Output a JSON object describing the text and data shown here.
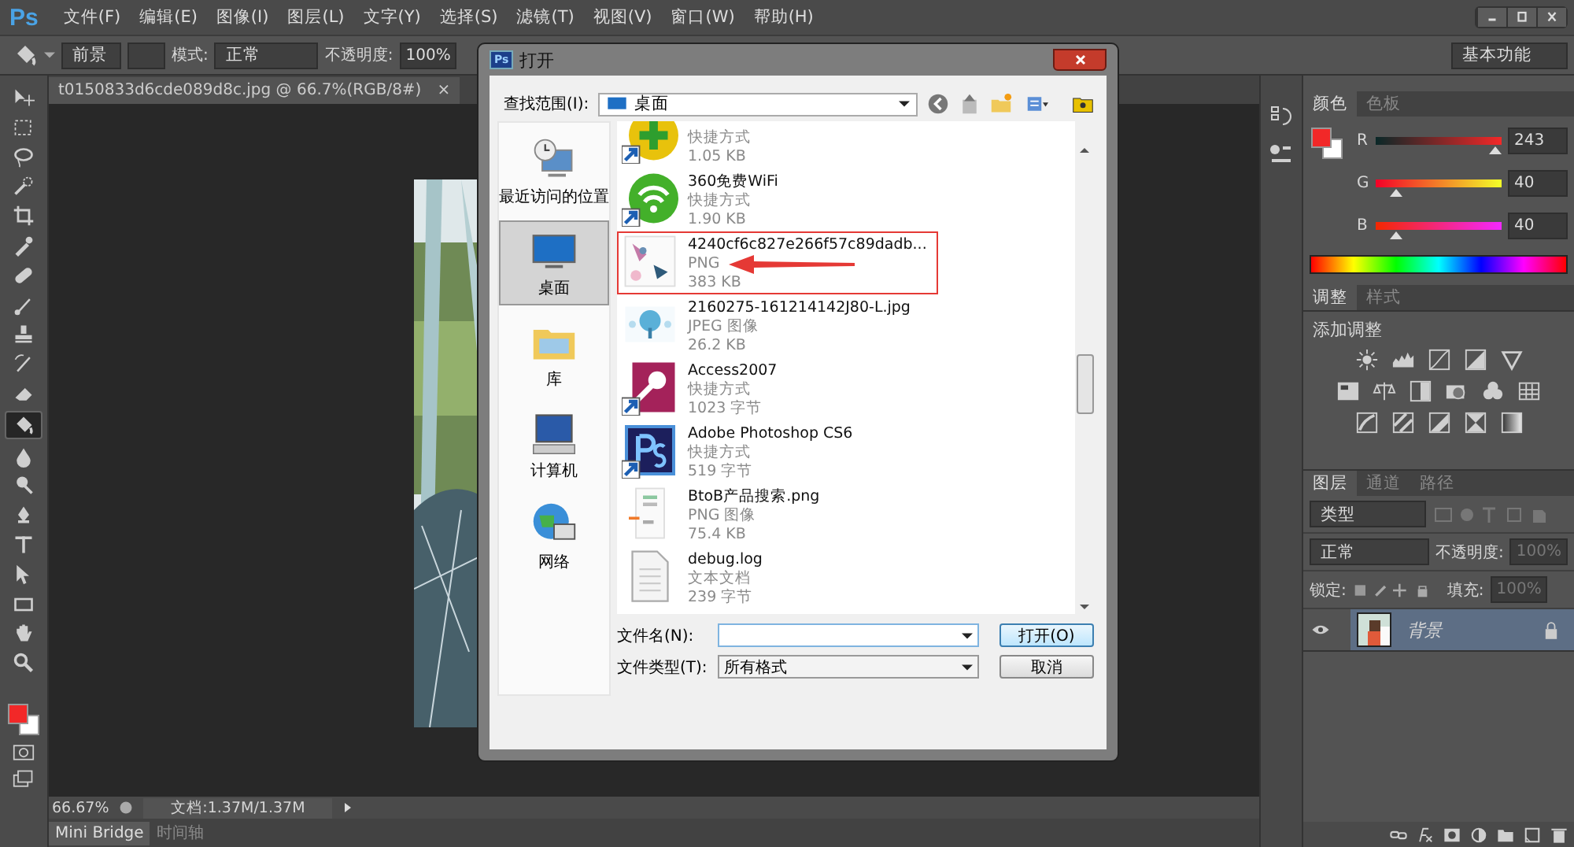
{
  "app": {
    "logo": "Ps"
  },
  "menu": [
    {
      "label": "文件(F)"
    },
    {
      "label": "编辑(E)"
    },
    {
      "label": "图像(I)"
    },
    {
      "label": "图层(L)"
    },
    {
      "label": "文字(Y)"
    },
    {
      "label": "选择(S)"
    },
    {
      "label": "滤镜(T)"
    },
    {
      "label": "视图(V)"
    },
    {
      "label": "窗口(W)"
    },
    {
      "label": "帮助(H)"
    }
  ],
  "options_bar": {
    "fill_source": "前景",
    "mode_label": "模式:",
    "mode": "正常",
    "opacity_label": "不透明度:",
    "opacity": "100%",
    "workspace": "基本功能"
  },
  "document_tab": {
    "title": "t0150833d6cde089d8c.jpg @ 66.7%(RGB/8#)",
    "close": "×"
  },
  "tools": [
    {
      "kind": "move",
      "selected": false
    },
    {
      "kind": "marquee",
      "selected": false
    },
    {
      "kind": "lasso",
      "selected": false
    },
    {
      "kind": "quick",
      "selected": false
    },
    {
      "kind": "crop",
      "selected": false
    },
    {
      "kind": "eyedropper",
      "selected": false
    },
    {
      "kind": "healing",
      "selected": false
    },
    {
      "kind": "brush",
      "selected": false
    },
    {
      "kind": "stamp",
      "selected": false
    },
    {
      "kind": "history",
      "selected": false
    },
    {
      "kind": "eraser",
      "selected": false
    },
    {
      "kind": "bucket",
      "selected": true
    },
    {
      "kind": "blur",
      "selected": false
    },
    {
      "kind": "dodge",
      "selected": false
    },
    {
      "kind": "pen",
      "selected": false
    },
    {
      "kind": "type",
      "selected": false
    },
    {
      "kind": "path",
      "selected": false
    },
    {
      "kind": "shape",
      "selected": false
    },
    {
      "kind": "hand",
      "selected": false
    },
    {
      "kind": "zoom",
      "selected": false
    }
  ],
  "swatches": [
    {
      "kind": "foreground",
      "color": "#f22828"
    },
    {
      "kind": "background",
      "color": "#ffffff"
    }
  ],
  "status_bar": {
    "zoom": "66.67%",
    "doc_size": "文档:1.37M/1.37M"
  },
  "bottom_tabs": [
    {
      "label": "Mini Bridge",
      "selected": true
    },
    {
      "label": "时间轴",
      "selected": false
    }
  ],
  "dialog": {
    "logo": "Ps",
    "title": "打开",
    "look_in_label": "查找范围(I):",
    "look_in": "桌面",
    "places": [
      {
        "kind": "recent",
        "label": "最近访问的位置",
        "selected": false
      },
      {
        "kind": "desktop",
        "label": "桌面",
        "selected": true
      },
      {
        "kind": "library",
        "label": "库",
        "selected": false
      },
      {
        "kind": "computer",
        "label": "计算机",
        "selected": false
      },
      {
        "kind": "network",
        "label": "网络",
        "selected": false
      }
    ],
    "files": [
      {
        "kind": "shortcut-plus",
        "type": "快捷方式",
        "size": "1.05 KB",
        "marked": false
      },
      {
        "kind": "shortcut-wifi",
        "name": "360免费WiFi",
        "type": "快捷方式",
        "size": "1.90 KB",
        "marked": false
      },
      {
        "kind": "thumb-birds",
        "name": "4240cf6c827e266f57c89dadb...",
        "type": "PNG",
        "size": "383 KB",
        "marked": true
      },
      {
        "kind": "thumb-tree",
        "name": "2160275-161214142J80-L.jpg",
        "type": "JPEG 图像",
        "size": "26.2 KB",
        "marked": false
      },
      {
        "kind": "shortcut-access",
        "name": "Access2007",
        "type": "快捷方式",
        "size": "1023 字节",
        "marked": false
      },
      {
        "kind": "shortcut-ps",
        "name": "Adobe Photoshop CS6",
        "type": "快捷方式",
        "size": "519 字节",
        "marked": false
      },
      {
        "kind": "thumb-page",
        "name": "BtoB产品搜索.png",
        "type": "PNG 图像",
        "size": "75.4 KB",
        "marked": false
      },
      {
        "kind": "text-doc",
        "name": "debug.log",
        "type": "文本文档",
        "size": "239 字节",
        "marked": false
      }
    ],
    "file_name_label": "文件名(N):",
    "file_type_label": "文件类型(T):",
    "file_type": "所有格式",
    "buttons": [
      {
        "label": "打开(O)",
        "kind": "default"
      },
      {
        "label": "取消",
        "kind": "normal"
      }
    ]
  },
  "color_panel": {
    "tabs": [
      {
        "label": "颜色",
        "selected": true
      },
      {
        "label": "色板",
        "selected": false
      }
    ],
    "channels": [
      {
        "label": "R",
        "level": 0.953,
        "value": "243",
        "kind": "red"
      },
      {
        "label": "G",
        "level": 0.157,
        "value": "40",
        "kind": "green"
      },
      {
        "label": "B",
        "level": 0.157,
        "value": "40",
        "kind": "blue"
      }
    ]
  },
  "adjustments_panel": {
    "tabs": [
      {
        "label": "调整",
        "selected": true
      },
      {
        "label": "样式",
        "selected": false
      }
    ],
    "heading": "添加调整",
    "icon_rows": [
      [
        {
          "kind": "sun"
        },
        {
          "kind": "histogram"
        },
        {
          "kind": "curve"
        },
        {
          "kind": "exposure"
        },
        {
          "kind": "triangle"
        }
      ],
      [
        {
          "kind": "hue"
        },
        {
          "kind": "scales"
        },
        {
          "kind": "halves"
        },
        {
          "kind": "camera"
        },
        {
          "kind": "circles"
        },
        {
          "kind": "grid"
        }
      ],
      [
        {
          "kind": "invert"
        },
        {
          "kind": "stripes"
        },
        {
          "kind": "threshold"
        },
        {
          "kind": "hourglass"
        },
        {
          "kind": "gradient"
        }
      ]
    ]
  },
  "layers_panel": {
    "tabs": [
      {
        "label": "图层",
        "selected": true
      },
      {
        "label": "通道",
        "selected": false
      },
      {
        "label": "路径",
        "selected": false
      }
    ],
    "filter": "类型",
    "blend_mode": "正常",
    "opacity_label": "不透明度:",
    "opacity": "100%",
    "lock_label": "锁定:",
    "fill_label": "填充:",
    "fill": "100%",
    "layers": [
      {
        "name": "背景",
        "visible": true,
        "selected": true,
        "locked": true
      }
    ]
  }
}
